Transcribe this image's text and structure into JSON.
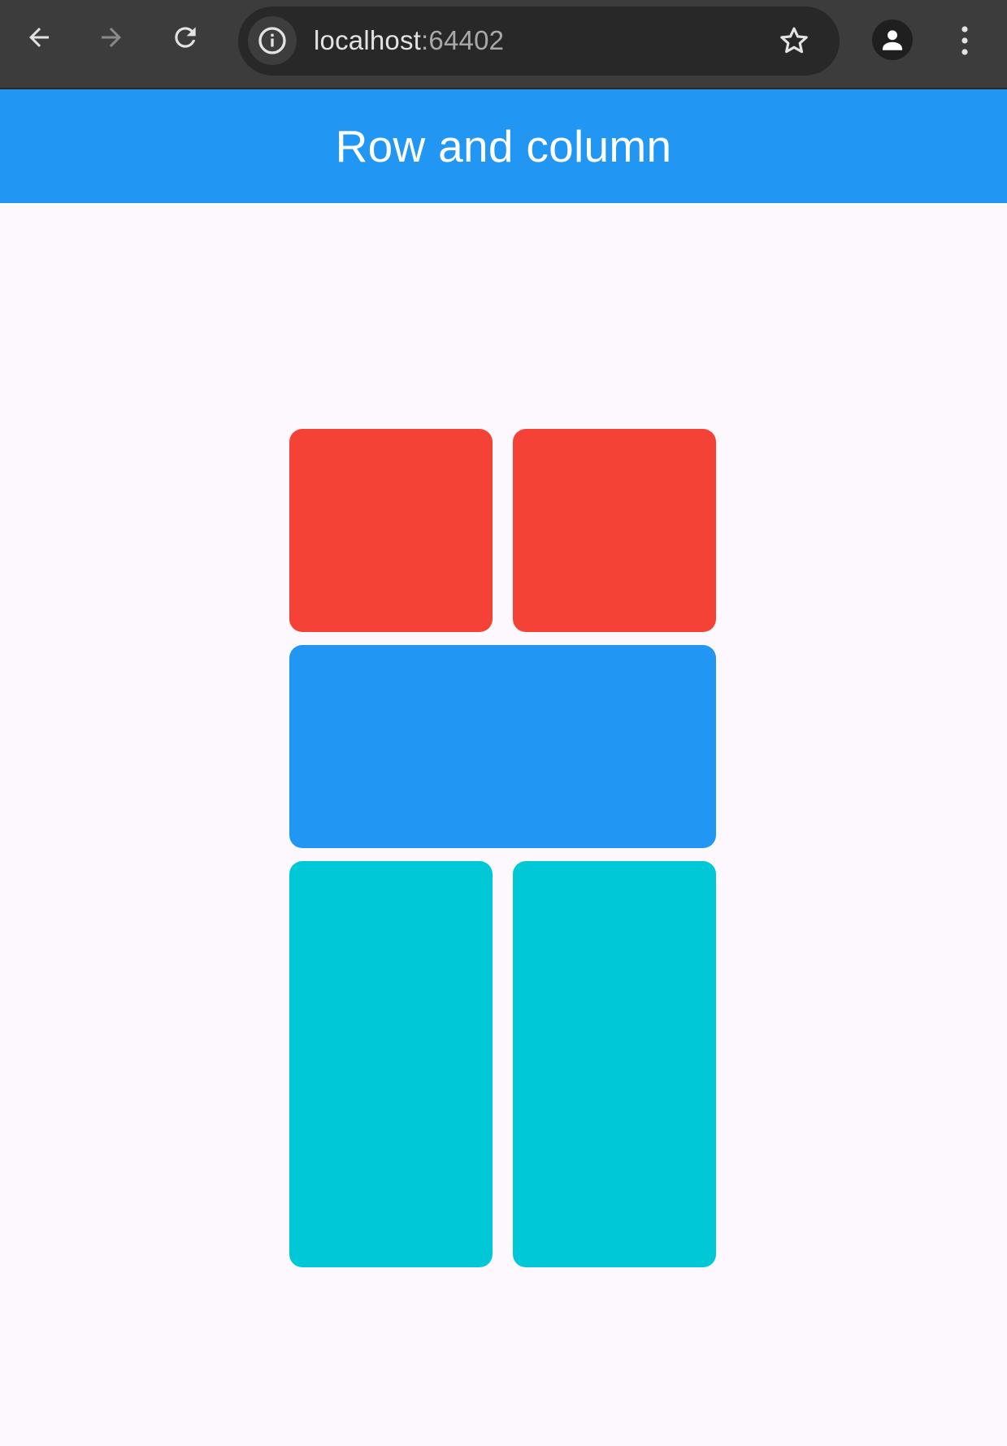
{
  "browser": {
    "url_host": "localhost",
    "url_port": ":64402"
  },
  "app": {
    "title": "Row and column"
  },
  "colors": {
    "app_bar": "#2196f3",
    "red": "#f44336",
    "blue": "#2196f3",
    "cyan": "#00c8d6",
    "background": "#fdf7fe"
  },
  "icons": {
    "back": "arrow-left-icon",
    "forward": "arrow-right-icon",
    "reload": "reload-icon",
    "site_info": "info-icon",
    "bookmark": "star-icon",
    "profile": "person-icon",
    "menu": "more-vertical-icon"
  }
}
